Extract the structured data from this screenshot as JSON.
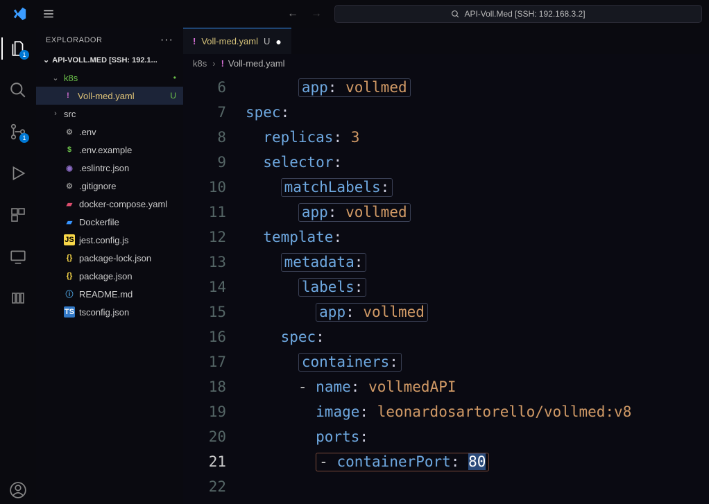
{
  "commandCenter": "API-Voll.Med [SSH: 192.168.3.2]",
  "sidebar": {
    "title": "EXPLORADOR",
    "root": "API-VOLL.MED [SSH: 192.1...",
    "tree": {
      "k8s": "k8s",
      "vollmed": "Voll-med.yaml",
      "vollmedStatus": "U",
      "src": "src",
      "env": ".env",
      "envExample": ".env.example",
      "eslint": ".eslintrc.json",
      "gitignore": ".gitignore",
      "dockerCompose": "docker-compose.yaml",
      "dockerfile": "Dockerfile",
      "jest": "jest.config.js",
      "pkgLock": "package-lock.json",
      "pkg": "package.json",
      "readme": "README.md",
      "tsconfig": "tsconfig.json"
    }
  },
  "activity": {
    "explorerBadge": "1",
    "scmBadge": "1"
  },
  "tab": {
    "name": "Voll-med.yaml",
    "status": "U"
  },
  "breadcrumbs": {
    "seg1": "k8s",
    "seg2": "Voll-med.yaml"
  },
  "lineNumbers": [
    "6",
    "7",
    "8",
    "9",
    "10",
    "11",
    "12",
    "13",
    "14",
    "15",
    "16",
    "17",
    "18",
    "19",
    "20",
    "21",
    "22"
  ],
  "currentLine": 21,
  "code": {
    "l6": {
      "k": "app",
      "v": "vollmed"
    },
    "l7": {
      "k": "spec"
    },
    "l8": {
      "k": "replicas",
      "v": "3"
    },
    "l9": {
      "k": "selector"
    },
    "l10": {
      "k": "matchLabels"
    },
    "l11": {
      "k": "app",
      "v": "vollmed"
    },
    "l12": {
      "k": "template"
    },
    "l13": {
      "k": "metadata"
    },
    "l14": {
      "k": "labels"
    },
    "l15": {
      "k": "app",
      "v": "vollmed"
    },
    "l16": {
      "k": "spec"
    },
    "l17": {
      "k": "containers"
    },
    "l18": {
      "k": "name",
      "v": "vollmedAPI"
    },
    "l19": {
      "k": "image",
      "v": "leonardosartorello/vollmed:v8"
    },
    "l20": {
      "k": "ports"
    },
    "l21": {
      "k": "containerPort",
      "v": "80"
    }
  }
}
